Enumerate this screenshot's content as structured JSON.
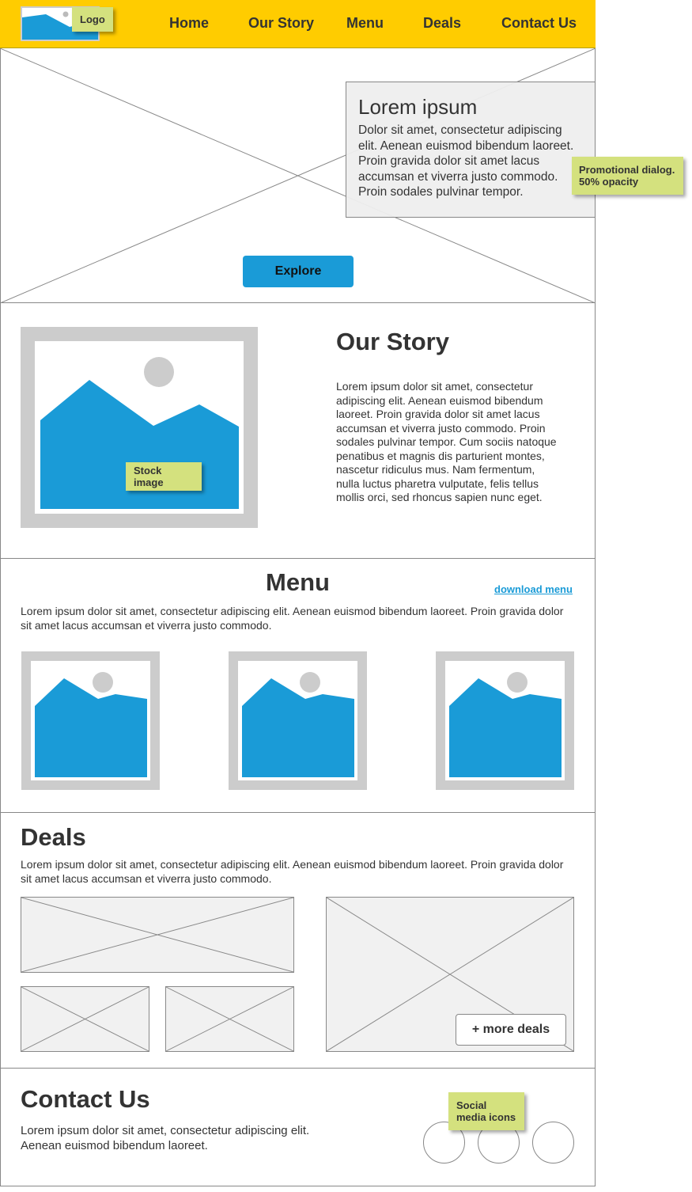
{
  "header": {
    "logo_label": "Logo",
    "nav": [
      "Home",
      "Our Story",
      "Menu",
      "Deals",
      "Contact Us"
    ],
    "background_color": "#ffcc00"
  },
  "hero": {
    "promo_title": "Lorem ipsum",
    "promo_text": "Dolor sit amet, consectetur adipiscing elit. Aenean euismod bibendum laoreet. Proin gravida dolor sit amet lacus accumsan et viverra justo commodo. Proin sodales pulvinar tempor.",
    "explore_label": "Explore",
    "promo_note": "Promotional dialog. 50% opacity"
  },
  "story": {
    "title": "Our Story",
    "text": "Lorem ipsum dolor sit amet, consectetur adipiscing elit. Aenean euismod bibendum laoreet. Proin gravida dolor sit amet lacus accumsan et viverra justo commodo. Proin sodales pulvinar tempor. Cum sociis natoque penatibus et magnis dis parturient montes, nascetur ridiculus mus. Nam fermentum, nulla luctus pharetra vulputate, felis tellus mollis orci, sed rhoncus sapien nunc eget.",
    "image_note": "Stock image"
  },
  "menu": {
    "title": "Menu",
    "download_label": "download menu",
    "text": "Lorem ipsum dolor sit amet, consectetur adipiscing elit. Aenean euismod bibendum laoreet. Proin gravida dolor sit amet lacus accumsan et viverra justo commodo."
  },
  "deals": {
    "title": "Deals",
    "text": "Lorem ipsum dolor sit amet, consectetur adipiscing elit. Aenean euismod bibendum laoreet. Proin gravida dolor sit amet lacus accumsan et viverra justo commodo.",
    "more_label": "+ more deals"
  },
  "contact": {
    "title": "Contact Us",
    "text": "Lorem ipsum dolor sit amet, consectetur adipiscing elit. Aenean euismod bibendum laoreet.",
    "social_note": "Social media icons"
  },
  "colors": {
    "accent": "#1a9bd7",
    "note": "#d4e17e",
    "placeholder": "#cccccc"
  },
  "icons": [
    "image-placeholder-icon",
    "social-icon"
  ]
}
